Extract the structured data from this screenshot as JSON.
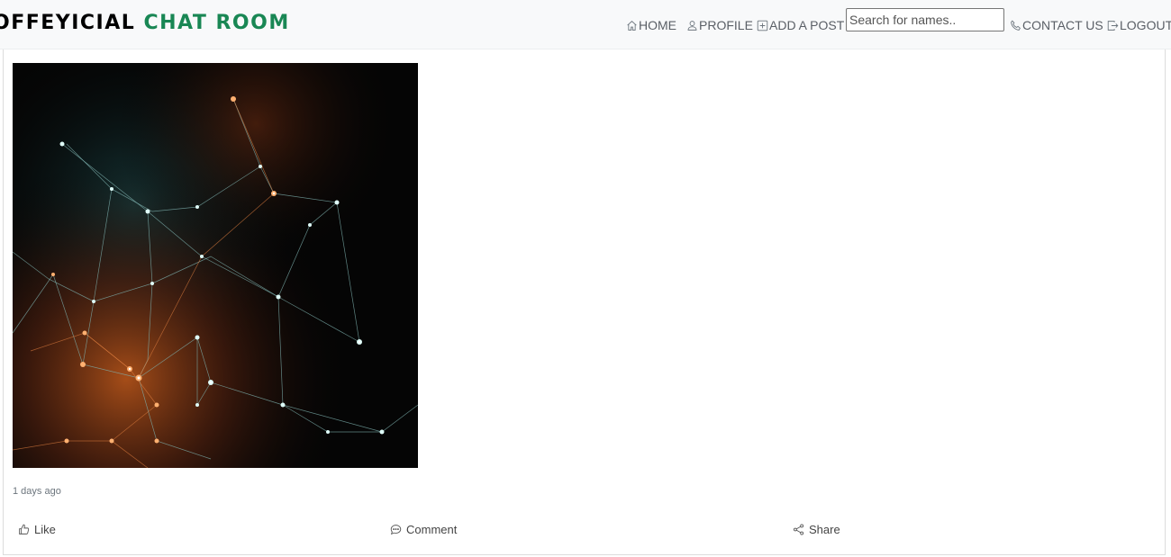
{
  "brand": {
    "prefix": "OFFEYICIAL",
    "accent": "CHAT ROOM",
    "accent_color": "#198754"
  },
  "nav": {
    "home": {
      "label": "HOME",
      "icon": "house-icon"
    },
    "profile": {
      "label": "PROFILE",
      "icon": "person-icon"
    },
    "add_post": {
      "label": "ADD A POST",
      "icon": "plus-square-icon"
    },
    "search": {
      "placeholder": "Search for names.."
    },
    "contact": {
      "label": "CONTACT US",
      "icon": "telephone-icon"
    },
    "logout": {
      "label": "LOGOUT",
      "icon": "box-arrow-right-icon"
    }
  },
  "post": {
    "image_alt": "abstract glowing network of connected nodes",
    "time": "1 days ago",
    "actions": {
      "like": {
        "label": "Like",
        "icon": "hand-thumbs-up-icon"
      },
      "comment": {
        "label": "Comment",
        "icon": "chat-dots-icon"
      },
      "share": {
        "label": "Share",
        "icon": "share-icon"
      }
    }
  },
  "colors": {
    "navbar_bg": "#f8f9fa",
    "nav_text": "#5a5f66",
    "image_bg": "#050505"
  }
}
